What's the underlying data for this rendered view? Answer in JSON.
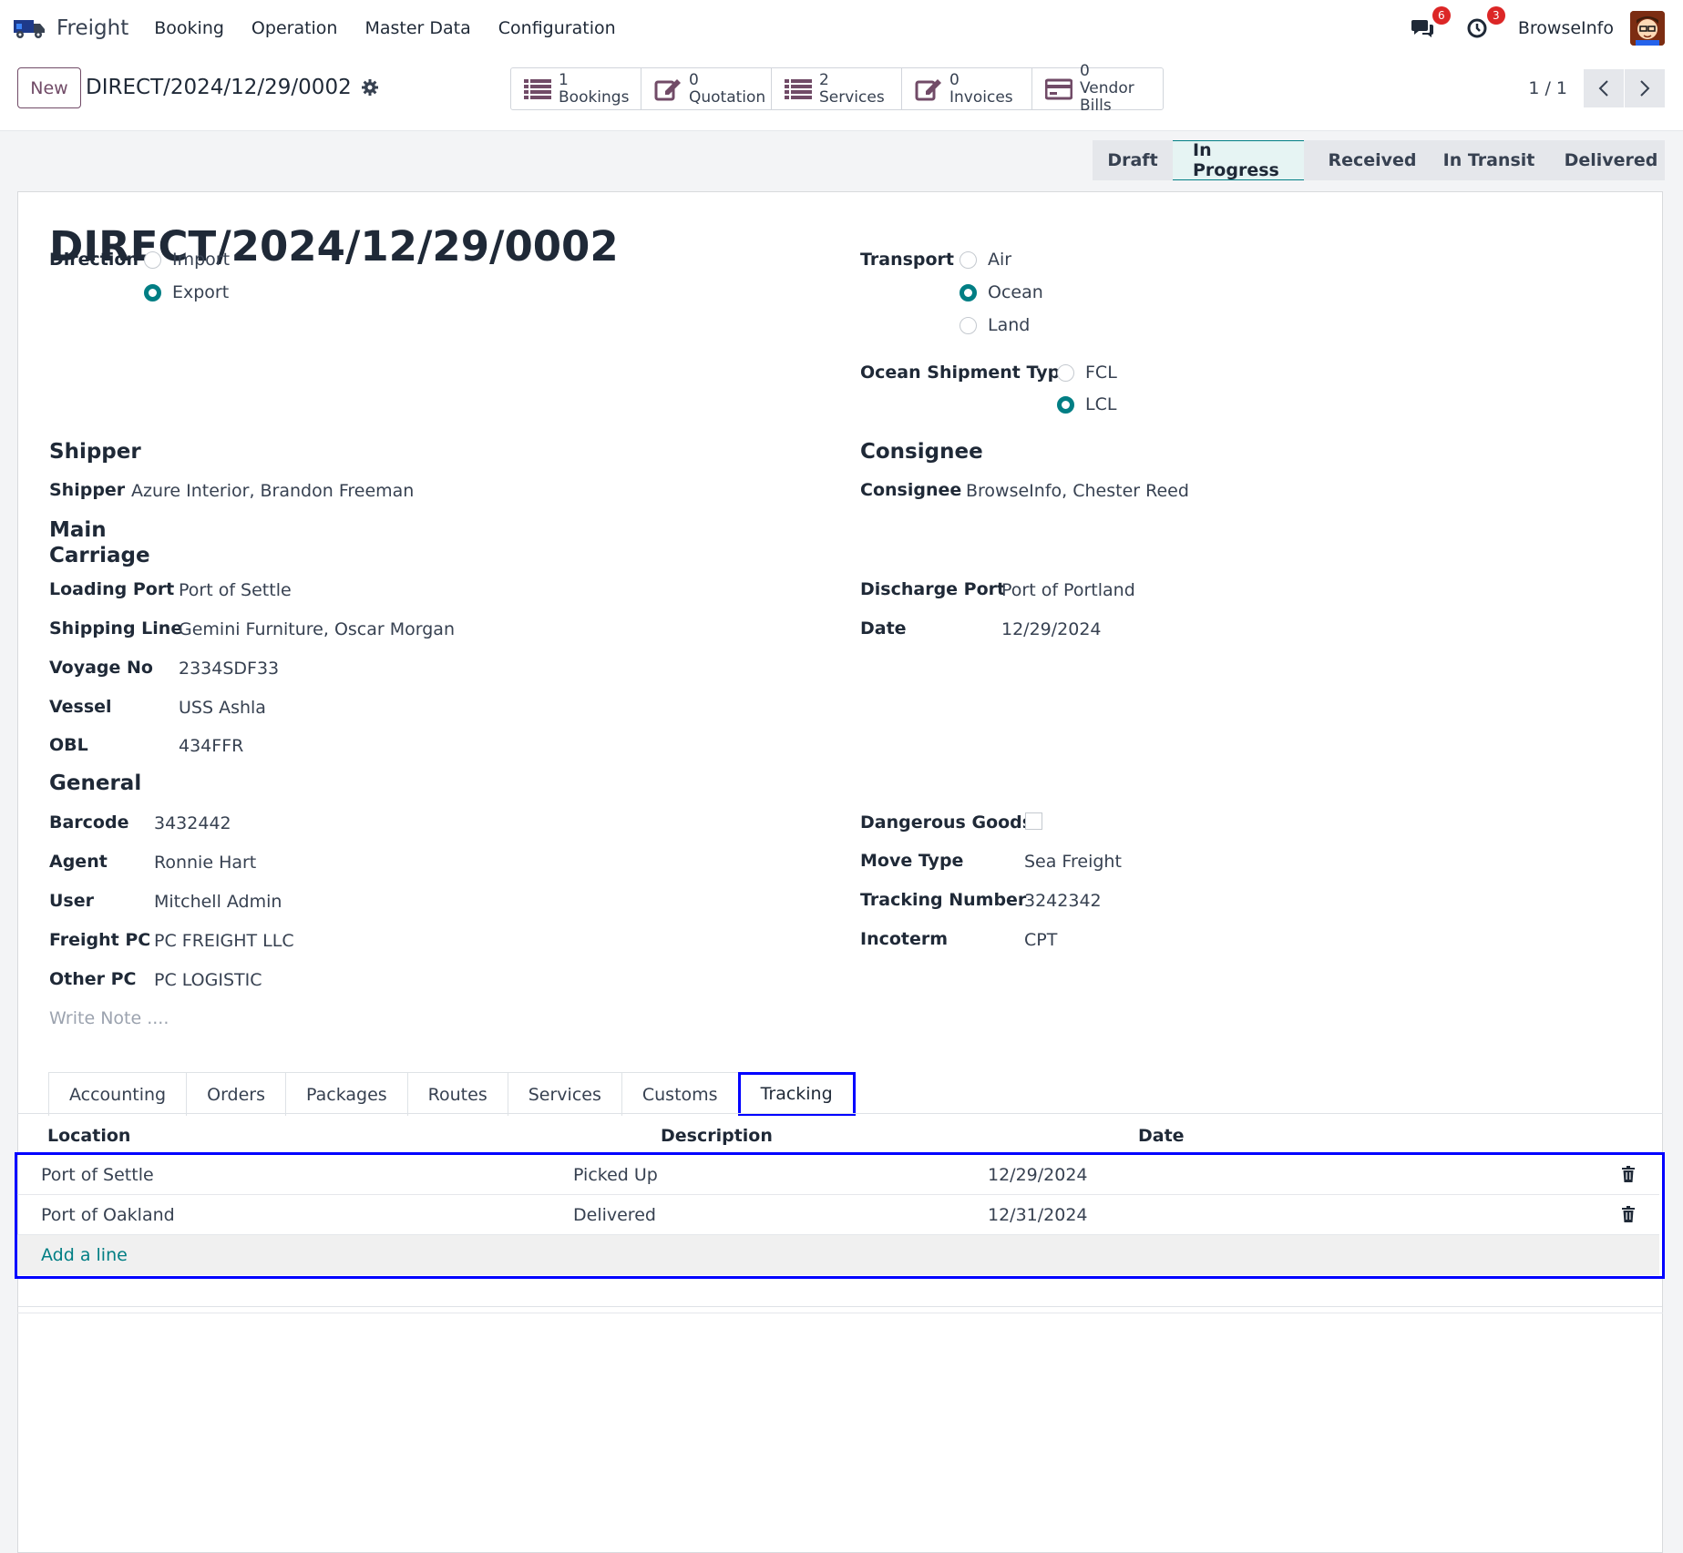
{
  "nav": {
    "app_name": "Freight",
    "menu": [
      "Booking",
      "Operation",
      "Master Data",
      "Configuration"
    ],
    "messages_count": "6",
    "activities_count": "3",
    "user": "BrowseInfo"
  },
  "control": {
    "new_label": "New",
    "record_name": "DIRECT/2024/12/29/0002",
    "smart_buttons": [
      {
        "count": "1",
        "label": "Bookings",
        "icon": "list-icon"
      },
      {
        "count": "0",
        "label": "Quotation",
        "icon": "edit-icon"
      },
      {
        "count": "2",
        "label": "Services",
        "icon": "list-icon"
      },
      {
        "count": "0",
        "label": "Invoices",
        "icon": "edit-icon"
      },
      {
        "count": "0",
        "label": "Vendor Bills",
        "icon": "credit-card-icon"
      }
    ],
    "pager": "1 / 1"
  },
  "status_stages": [
    "Draft",
    "In Progress",
    "Received",
    "In Transit",
    "Delivered"
  ],
  "status_active": "In Progress",
  "form": {
    "title": "DIRECT/2024/12/29/0002",
    "direction": {
      "label": "Direction",
      "options": [
        "Import",
        "Export"
      ],
      "selected": "Export"
    },
    "transport": {
      "label": "Transport",
      "options": [
        "Air",
        "Ocean",
        "Land"
      ],
      "selected": "Ocean"
    },
    "ocean_type": {
      "label": "Ocean Shipment Type",
      "options": [
        "FCL",
        "LCL"
      ],
      "selected": "LCL"
    },
    "shipper_section": "Shipper",
    "shipper_label": "Shipper",
    "shipper_value": "Azure Interior, Brandon Freeman",
    "consignee_section": "Consignee",
    "consignee_label": "Consignee",
    "consignee_value": "BrowseInfo, Chester Reed",
    "main_carriage_l1": "Main",
    "main_carriage_l2": "Carriage",
    "loading_port_label": "Loading Port",
    "loading_port": "Port of Settle",
    "shipping_line_label": "Shipping Line",
    "shipping_line": "Gemini Furniture, Oscar Morgan",
    "voyage_label": "Voyage No",
    "voyage": "2334SDF33",
    "vessel_label": "Vessel",
    "vessel": "USS Ashla",
    "obl_label": "OBL",
    "obl": "434FFR",
    "discharge_port_label": "Discharge Port",
    "discharge_port": "Port of Portland",
    "date_label": "Date",
    "date": "12/29/2024",
    "general_section": "General",
    "barcode_label": "Barcode",
    "barcode": "3432442",
    "agent_label": "Agent",
    "agent": "Ronnie Hart",
    "user_label": "User",
    "user": "Mitchell Admin",
    "freight_pc_label": "Freight PC",
    "freight_pc": "PC FREIGHT LLC",
    "other_pc_label": "Other PC",
    "other_pc": "PC LOGISTIC",
    "dangerous_label": "Dangerous Goods",
    "move_type_label": "Move Type",
    "move_type": "Sea Freight",
    "tracking_number_label": "Tracking Number",
    "tracking_number": "3242342",
    "incoterm_label": "Incoterm",
    "incoterm": "CPT",
    "note_placeholder": "Write Note ...."
  },
  "tabs": [
    "Accounting",
    "Orders",
    "Packages",
    "Routes",
    "Services",
    "Customs",
    "Tracking"
  ],
  "active_tab": "Tracking",
  "tracking": {
    "columns": [
      "Location",
      "Description",
      "Date"
    ],
    "rows": [
      {
        "location": "Port of Settle",
        "description": "Picked Up",
        "date": "12/29/2024"
      },
      {
        "location": "Port of Oakland",
        "description": "Delivered",
        "date": "12/31/2024"
      }
    ],
    "add_line": "Add a line"
  },
  "colors": {
    "brand": "#714B67",
    "accent": "#017e84",
    "highlight": "#0000ff"
  }
}
